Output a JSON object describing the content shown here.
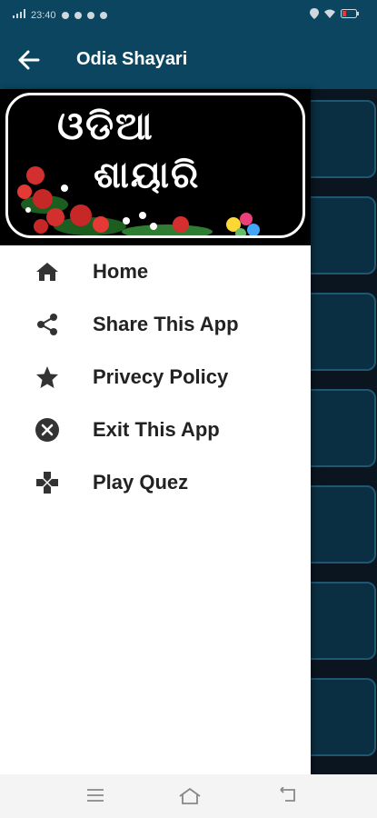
{
  "status_bar": {
    "time": "23:40"
  },
  "app_bar": {
    "title": "Odia Shayari"
  },
  "drawer": {
    "logo": {
      "line1": "ଓଡିଆ",
      "line2": "ଶାୟାରି"
    },
    "menu": [
      {
        "label": "Home",
        "icon": "home-icon"
      },
      {
        "label": "Share This App",
        "icon": "share-icon"
      },
      {
        "label": "Privecy Policy",
        "icon": "star-icon"
      },
      {
        "label": "Exit This App",
        "icon": "close-circle-icon"
      },
      {
        "label": "Play Quez",
        "icon": "gamepad-icon"
      }
    ]
  },
  "colors": {
    "app_bar": "#0b4560",
    "content_bg": "#0a1520",
    "card_bg": "#0a2f42",
    "card_border": "#1f5773",
    "drawer_bg": "#ffffff",
    "menu_text": "#222222"
  }
}
